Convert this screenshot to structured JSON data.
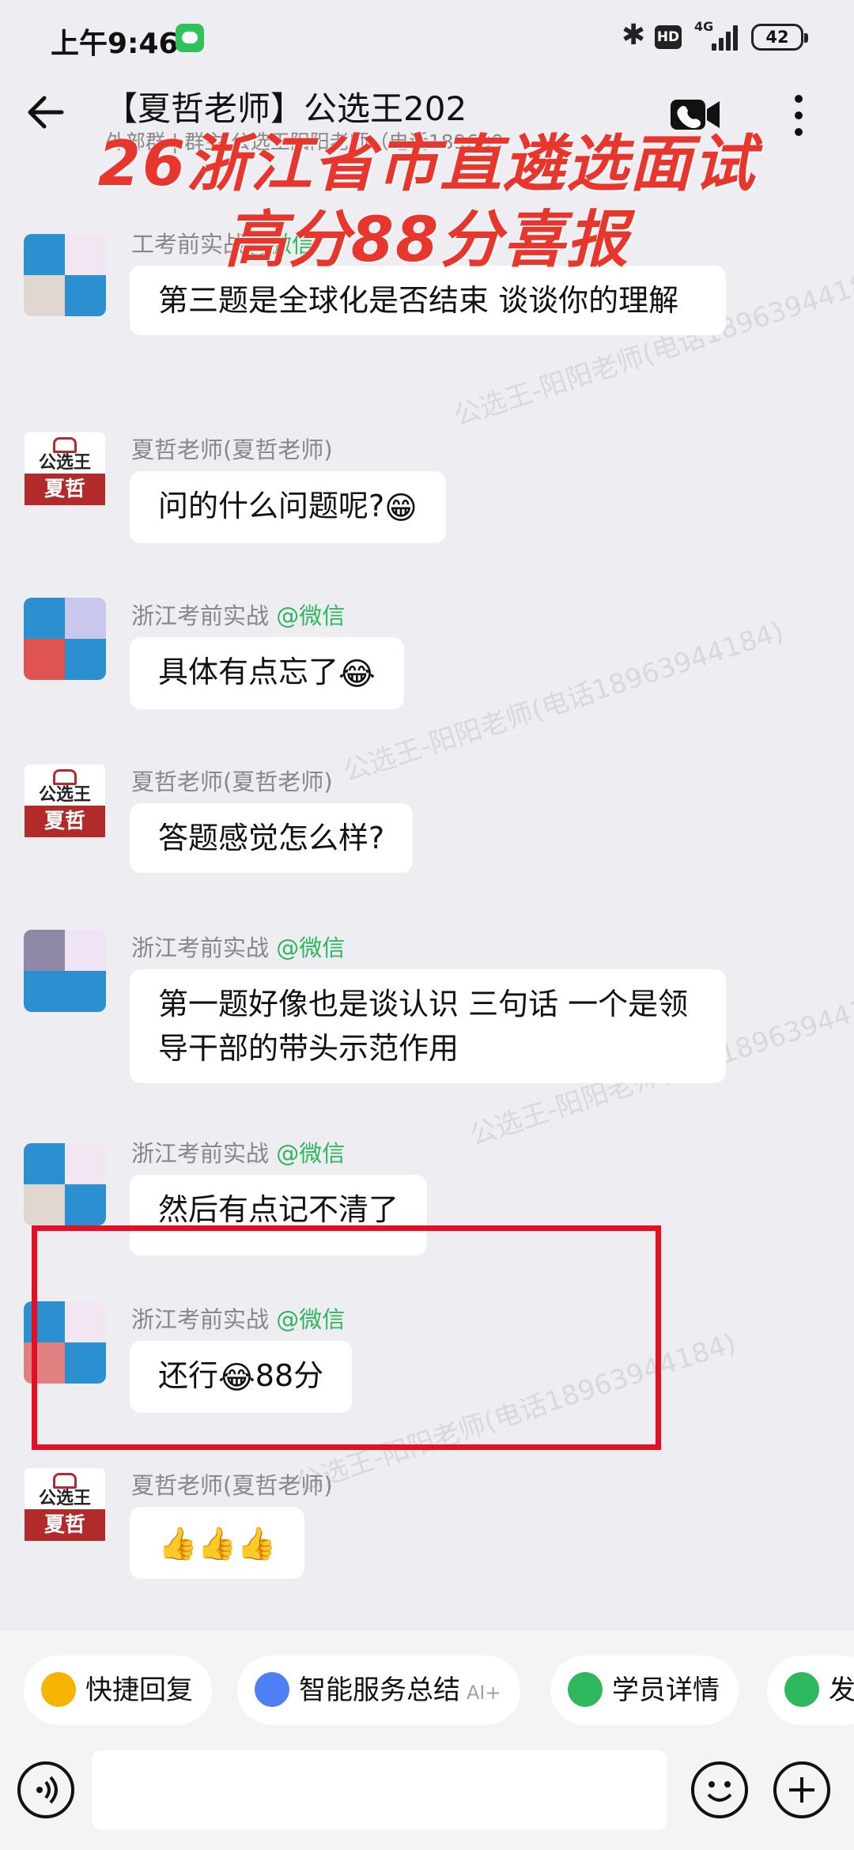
{
  "status_bar": {
    "time": "上午9:46",
    "hd": "HD",
    "network": "4G",
    "battery": "42"
  },
  "header": {
    "title": "【夏哲老师】公选王202",
    "subtitle": "外部群 | 群主:公选王阳阳老师（电话189639"
  },
  "banner": {
    "line1": "26浙江省市直遴选面试",
    "line2": "高分88分喜报"
  },
  "watermark": "公选王-阳阳老师(电话18963944184)",
  "messages": [
    {
      "sender": "工考前实战",
      "wx": "@微信",
      "text": "第三题是全球化是否结束 谈谈你的理解",
      "avatar": "student"
    },
    {
      "sender": "夏哲老师(夏哲老师)",
      "wx": "",
      "text": "问的什么问题呢?",
      "emoji": "😁",
      "avatar": "teacher"
    },
    {
      "sender": "浙江考前实战",
      "wx": "@微信",
      "text": "具体有点忘了",
      "emoji": "😂",
      "avatar": "student"
    },
    {
      "sender": "夏哲老师(夏哲老师)",
      "wx": "",
      "text": "答题感觉怎么样?",
      "avatar": "teacher"
    },
    {
      "sender": "浙江考前实战",
      "wx": "@微信",
      "text": "第一题好像也是谈认识 三句话 一个是领导干部的带头示范作用",
      "avatar": "student"
    },
    {
      "sender": "浙江考前实战",
      "wx": "@微信",
      "text": "然后有点记不清了",
      "avatar": "student"
    },
    {
      "sender": "浙江考前实战",
      "wx": "@微信",
      "text_before": "还行",
      "emoji": "😂",
      "text_after": "88分",
      "avatar": "student"
    },
    {
      "sender": "夏哲老师(夏哲老师)",
      "wx": "",
      "text": "👍👍👍",
      "avatar": "teacher"
    }
  ],
  "avatar_logo": {
    "top": "公选王",
    "bottom": "夏哲"
  },
  "quick_actions": [
    {
      "label": "快捷回复",
      "color": "#f5b400"
    },
    {
      "label": "智能服务总结",
      "tag": "AI+",
      "color": "#4e7ff5"
    },
    {
      "label": "学员详情",
      "color": "#2fb75d"
    },
    {
      "label": "发",
      "color": "#2fb75d"
    }
  ],
  "input": {
    "placeholder": ""
  }
}
